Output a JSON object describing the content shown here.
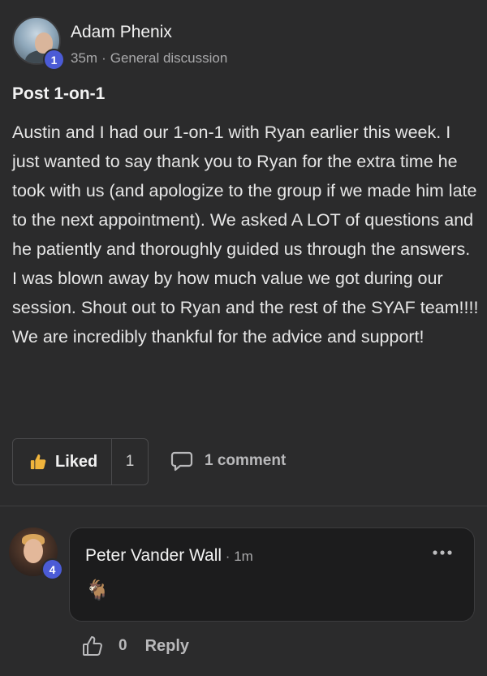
{
  "post": {
    "author": "Adam Phenix",
    "author_badge": "1",
    "time": "35m",
    "meta_separator": "·",
    "category": "General discussion",
    "title": "Post 1-on-1",
    "body": "Austin and I had our 1-on-1 with Ryan earlier this week. I just wanted to say thank you to Ryan for the extra time he took with us (and apologize to the group if we made him late to the next appointment). We asked A LOT of questions and he patiently and thoroughly guided us through the answers. I was blown away by how much value we got during our session. Shout out to Ryan and the rest of the SYAF team!!!! We are incredibly thankful for the advice and support!"
  },
  "actions": {
    "like_label": "Liked",
    "like_count": "1",
    "comment_label": "1 comment"
  },
  "comment": {
    "author": "Peter Vander Wall",
    "author_badge": "4",
    "time_separator": " · ",
    "time": "1m",
    "content": "🐐",
    "like_count": "0",
    "reply_label": "Reply"
  },
  "colors": {
    "accent_badge": "#4b5bd6",
    "liked_icon": "#f0b43c",
    "background": "#2b2b2c"
  },
  "icons": {
    "like": "thumbs-up-icon",
    "comment": "speech-bubble-icon",
    "more": "ellipsis-icon"
  }
}
